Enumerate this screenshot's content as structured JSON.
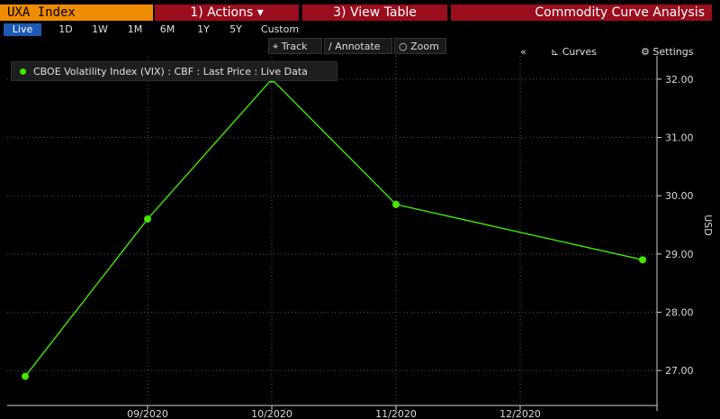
{
  "header": {
    "ticker": "UXA Index",
    "actions_label": "1) Actions ▾",
    "view_table_label": "3) View Table",
    "analysis_label": "Commodity Curve Analysis"
  },
  "periods": [
    "Live",
    "1D",
    "1W",
    "1M",
    "6M",
    "1Y",
    "5Y",
    "Custom"
  ],
  "selected_period": "Live",
  "controls": {
    "collapse_label": "«",
    "curves_label": "Curves",
    "settings_label": "Settings"
  },
  "tools": {
    "track_label": "Track",
    "annotate_label": "Annotate",
    "zoom_label": "Zoom"
  },
  "legend": {
    "label": "CBOE Volatility Index (VIX) : CBF : Last Price : Live Data"
  },
  "colors": {
    "ticker_bg": "#f08c00",
    "red_button_bg": "#9a0d1d",
    "live_bg": "#1e5ab4",
    "series_color": "#42e600",
    "grid_color": "#555555"
  },
  "chart_data": {
    "type": "line",
    "series": [
      {
        "name": "CBOE Volatility Index (VIX) : CBF : Last Price : Live Data",
        "values": [
          26.9,
          29.6,
          32.0,
          29.85,
          28.9
        ]
      }
    ],
    "x_tick_labels": [
      "09/2020",
      "10/2020",
      "11/2020",
      "12/2020"
    ],
    "y_ticks": [
      27.0,
      28.0,
      29.0,
      30.0,
      31.0,
      32.0
    ],
    "y_tick_labels": [
      "27.00",
      "28.00",
      "29.00",
      "30.00",
      "31.00",
      "32.00"
    ],
    "ylabel": "USD",
    "ylim": [
      26.4,
      32.4
    ],
    "grid": true
  }
}
